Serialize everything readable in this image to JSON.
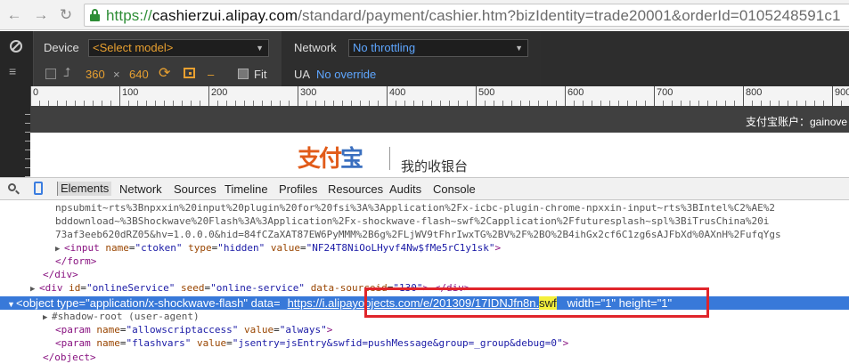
{
  "browser": {
    "url_scheme": "https://",
    "url_host": "cashierzui.alipay.com",
    "url_rest": "/standard/payment/cashier.htm?bizIdentity=trade20001&orderId=0105248591c1"
  },
  "emulation": {
    "device_label": "Device",
    "device_select": "<Select model>",
    "width": "360",
    "times": "×",
    "height": "640",
    "dash": "–",
    "fit_label": "Fit",
    "network_label": "Network",
    "network_select": "No throttling",
    "ua_label": "UA",
    "ua_value": "No override"
  },
  "ruler": {
    "labels": [
      "0",
      "100",
      "200",
      "300",
      "400",
      "500",
      "600",
      "700",
      "800",
      "900"
    ]
  },
  "page": {
    "account": "支付宝账户：gainove",
    "logo_text_1": "支付",
    "logo_text_2": "宝",
    "cashier": "我的收银台"
  },
  "devtools": {
    "tabs": [
      "Elements",
      "Network",
      "Sources",
      "Timeline",
      "Profiles",
      "Resources",
      "Audits",
      "Console"
    ],
    "code": {
      "l1": "npsubmit~rts%3Bnpxxin%20input%20plugin%20for%20fsi%3A%3Application%2Fx-icbc-plugin-chrome-npxxin-input~rts%3BIntel%C2%AE%2",
      "l2": "bddownload~%3BShockwave%20Flash%3A%3Application%2Fx-shockwave-flash~swf%2Capplication%2Ffuturesplash~spl%3BiTrusChina%20i",
      "l3": "73af3eeb620dRZ05&hv=1.0.0.0&hid=84fCZaXAT87EW6PyMMM%2B6g%2FLjWV9tFhrIwxTG%2BV%2F%2BO%2B4ihGx2cf6C1zg6sAJFbXd%0AXnH%2FufqYgs",
      "input_tag": "input",
      "input_name_attr": "name",
      "input_name_val": "\"ctoken\"",
      "input_type_attr": "type",
      "input_type_val": "\"hidden\"",
      "input_value_attr": "value",
      "input_value_val": "\"NF24T8NiOoLHyvf4Nw$fMe5rC1y1sk\"",
      "form_close": "</form>",
      "div_close": "</div>",
      "div_tag": "div",
      "div_id_attr": "id",
      "div_id_val": "\"onlineService\"",
      "div_seed_attr": "seed",
      "div_seed_val": "\"online-service\"",
      "div_ds_attr": "data-sourceid",
      "div_ds_val": "\"130\"",
      "div_tail": "> </div>",
      "obj_open": "<object",
      "obj_type_attr": "type",
      "obj_type_val": "\"application/x-shockwave-flash\"",
      "obj_data_attr": "data",
      "obj_url": "https://i.alipayobjects.com/e/201309/17IDNJfn8n.",
      "obj_url_ext": "swf",
      "obj_width_attr": "width",
      "obj_width_val": "\"1\"",
      "obj_height_attr": "height",
      "obj_height_val": "\"1\"",
      "shadow": "#shadow-root (user-agent)",
      "p1_name_attr": "name",
      "p1_name_val": "\"allowscriptaccess\"",
      "p1_value_attr": "value",
      "p1_value_val": "\"always\"",
      "p2_name_attr": "name",
      "p2_name_val": "\"flashvars\"",
      "p2_value_attr": "value",
      "p2_value_val": "\"jsentry=jsEntry&swfid=pushMessage&group=_group&debug=0\"",
      "param_tag": "param",
      "obj_close": "</object>"
    }
  }
}
